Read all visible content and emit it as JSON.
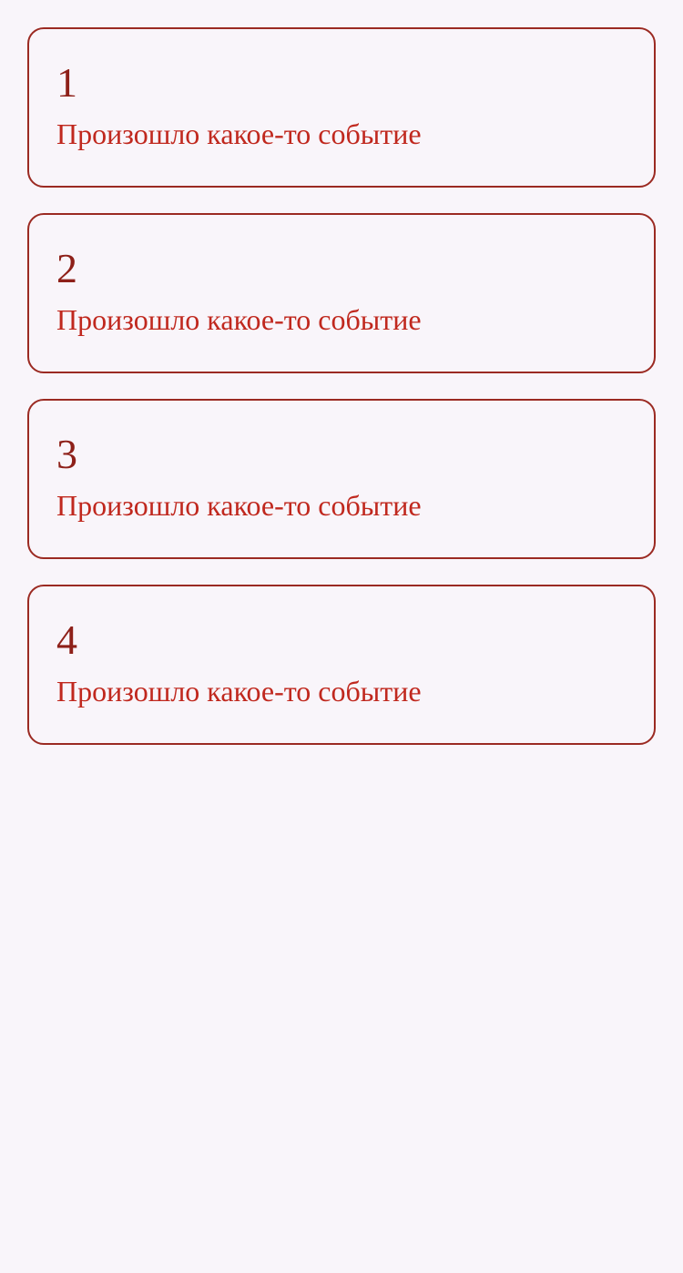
{
  "events": [
    {
      "number": "1",
      "text": "Произошло какое-то событие"
    },
    {
      "number": "2",
      "text": "Произошло какое-то событие"
    },
    {
      "number": "3",
      "text": "Произошло какое-то событие"
    },
    {
      "number": "4",
      "text": "Произошло какое-то событие"
    }
  ],
  "colors": {
    "background": "#f9f5fa",
    "border": "#9b2a22",
    "number": "#8e2019",
    "text": "#c0281e"
  }
}
